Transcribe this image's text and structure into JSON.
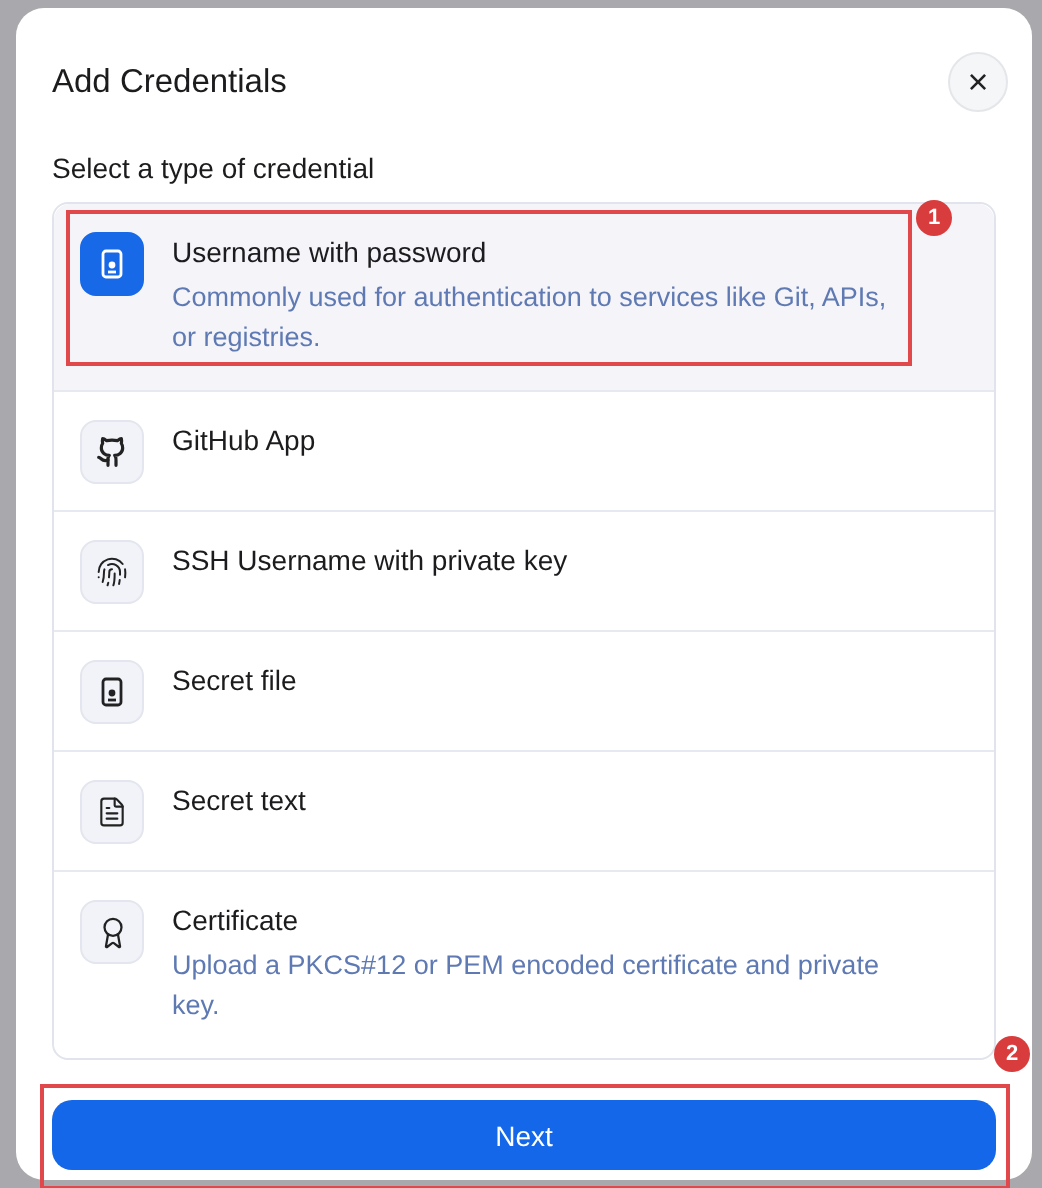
{
  "dialog": {
    "title": "Add Credentials",
    "close_label": "×"
  },
  "prompt": "Select a type of credential",
  "options": [
    {
      "kind": "password",
      "title": "Username with password",
      "description": "Commonly used for authentication to services like Git, APIs, or registries.",
      "selected": true,
      "callout": "1"
    },
    {
      "kind": "github",
      "title": "GitHub App",
      "selected": false
    },
    {
      "kind": "ssh",
      "title": "SSH Username with private key",
      "selected": false
    },
    {
      "kind": "file",
      "title": "Secret file",
      "selected": false
    },
    {
      "kind": "text",
      "title": "Secret text",
      "selected": false
    },
    {
      "kind": "certificate",
      "title": "Certificate",
      "description": "Upload a PKCS#12 or PEM encoded certificate and private key.",
      "selected": false
    }
  ],
  "next_button": {
    "label": "Next",
    "callout": "2"
  }
}
